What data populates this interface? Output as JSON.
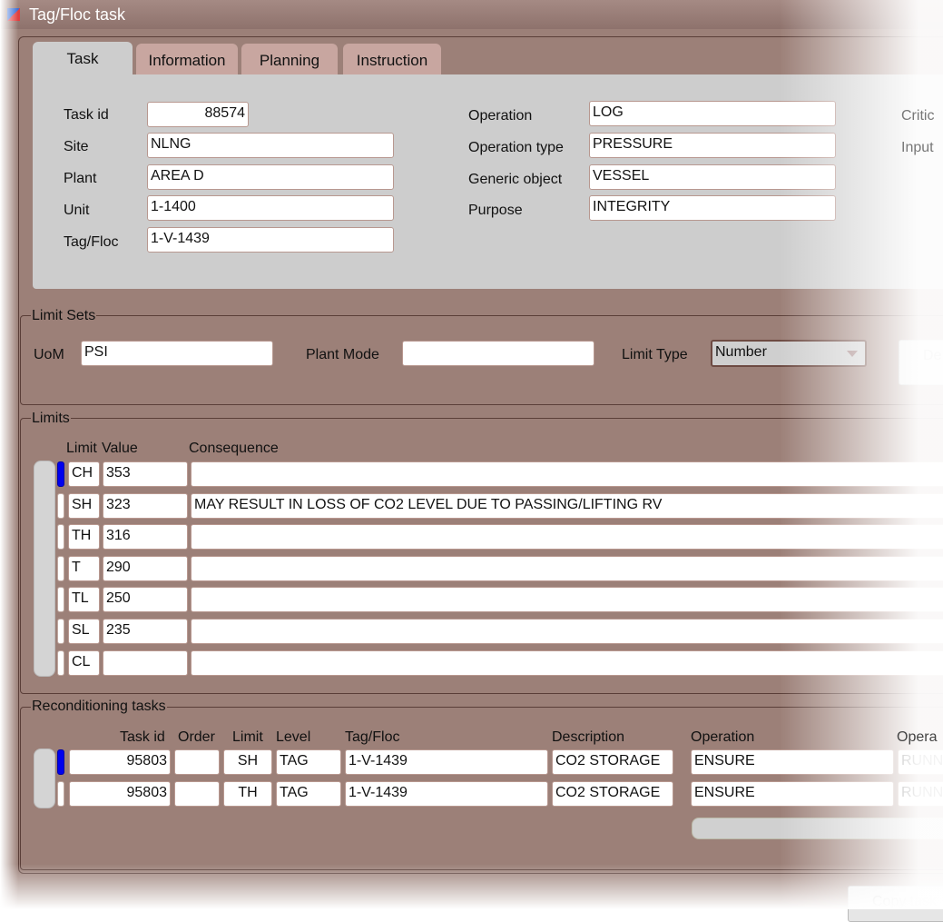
{
  "window": {
    "title": "Tag/Floc task"
  },
  "tabs": [
    {
      "label": "Task"
    },
    {
      "label": "Information"
    },
    {
      "label": "Planning"
    },
    {
      "label": "Instruction"
    }
  ],
  "task": {
    "task_id_label": "Task id",
    "task_id": "88574",
    "site_label": "Site",
    "site": "NLNG",
    "plant_label": "Plant",
    "plant": "AREA D",
    "unit_label": "Unit",
    "unit": "1-1400",
    "tagfloc_label": "Tag/Floc",
    "tagfloc": "1-V-1439",
    "operation_label": "Operation",
    "operation": "LOG",
    "operation_type_label": "Operation type",
    "operation_type": "PRESSURE",
    "generic_object_label": "Generic object",
    "generic_object": "VESSEL",
    "purpose_label": "Purpose",
    "purpose": "INTEGRITY",
    "critic_label": "Critic",
    "input_label": "Input"
  },
  "limit_sets": {
    "title": "Limit Sets",
    "uom_label": "UoM",
    "uom": "PSI",
    "plant_mode_label": "Plant Mode",
    "plant_mode": "",
    "limit_type_label": "Limit Type",
    "limit_type": "Number",
    "button_label": "De"
  },
  "limits": {
    "title": "Limits",
    "col_limit": "Limit",
    "col_value": "Value",
    "col_consequence": "Consequence",
    "rows": [
      {
        "limit": "CH",
        "value": "353",
        "consequence": ""
      },
      {
        "limit": "SH",
        "value": "323",
        "consequence": "MAY RESULT IN LOSS OF CO2 LEVEL DUE TO PASSING/LIFTING RV"
      },
      {
        "limit": "TH",
        "value": "316",
        "consequence": ""
      },
      {
        "limit": "T",
        "value": "290",
        "consequence": ""
      },
      {
        "limit": "TL",
        "value": "250",
        "consequence": ""
      },
      {
        "limit": "SL",
        "value": "235",
        "consequence": ""
      },
      {
        "limit": "CL",
        "value": "",
        "consequence": ""
      }
    ]
  },
  "recon": {
    "title": "Reconditioning tasks",
    "col_task_id": "Task id",
    "col_order": "Order",
    "col_limit": "Limit",
    "col_level": "Level",
    "col_tagfloc": "Tag/Floc",
    "col_description": "Description",
    "col_operation": "Operation",
    "col_opera": "Opera",
    "rows": [
      {
        "task_id": "95803",
        "order": "",
        "limit": "SH",
        "level": "TAG",
        "tagfloc": "1-V-1439",
        "description": "CO2 STORAGE",
        "operation": "ENSURE",
        "opera": "RUNN"
      },
      {
        "task_id": "95803",
        "order": "",
        "limit": "TH",
        "level": "TAG",
        "tagfloc": "1-V-1439",
        "description": "CO2 STORAGE",
        "operation": "ENSURE",
        "opera": "RUNN"
      }
    ]
  },
  "footer": {
    "copy_task_label": "Copy task"
  },
  "colors": {
    "background": "#9c8078",
    "panel": "#cdcdcd",
    "tab_inactive": "#c8a6a0",
    "row_marker": "#0000ee"
  }
}
